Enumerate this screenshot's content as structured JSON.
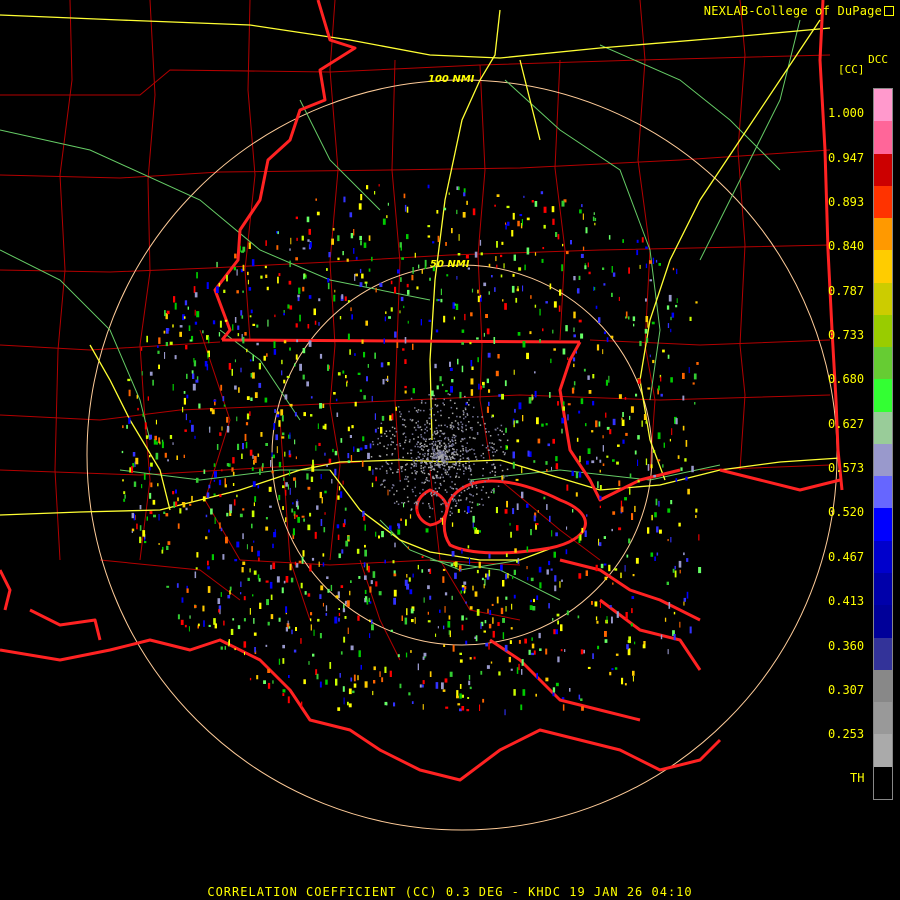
{
  "credit": "NEXLAB-College of DuPage",
  "product": {
    "code": "DCC",
    "unit": "[CC]"
  },
  "colorbar": {
    "ticks": [
      "1.000",
      "0.947",
      "0.893",
      "0.840",
      "0.787",
      "0.733",
      "0.680",
      "0.627",
      "0.573",
      "0.520",
      "0.467",
      "0.413",
      "0.360",
      "0.307",
      "0.253",
      "TH"
    ],
    "colors": [
      "#ff99cc",
      "#ff6699",
      "#cc0000",
      "#ff3300",
      "#ff9900",
      "#ffcc00",
      "#cccc00",
      "#99cc00",
      "#66cc33",
      "#33ff33",
      "#99cc99",
      "#9999cc",
      "#6666ff",
      "#0000ff",
      "#0000cc",
      "#0000aa",
      "#000099",
      "#333399",
      "#888888",
      "#999999",
      "#aaaaaa",
      "#000000"
    ]
  },
  "range_rings": {
    "outer_label": "100 NMI",
    "inner_label": "50 NMI"
  },
  "footer": "CORRELATION COEFFICIENT (CC) 0.3 DEG - KHDC 19 JAN 26 04:10",
  "colors": {
    "text": "#ffff00",
    "boundaries": "#cc0000",
    "state_lines": "#ff2222",
    "highways": "#ffff33",
    "roads": "#66cc66",
    "rings": "#ffcc99"
  }
}
